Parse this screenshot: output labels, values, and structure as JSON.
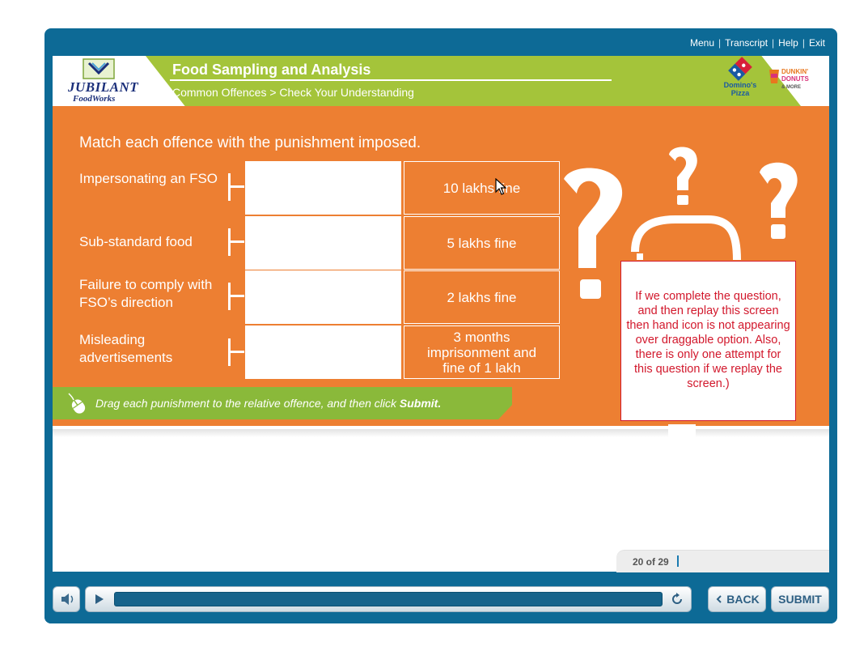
{
  "top_nav": {
    "menu": "Menu",
    "transcript": "Transcript",
    "help": "Help",
    "exit": "Exit"
  },
  "header": {
    "title": "Food Sampling and Analysis",
    "breadcrumb": "Common Offences > Check Your Understanding",
    "logo_left": {
      "name": "JUBILANT",
      "sub": "FoodWorks"
    },
    "logo_dominos": {
      "line1": "Domino's",
      "line2": "Pizza"
    },
    "logo_dunkin": {
      "line1": "DUNKIN'",
      "line2": "DONUTS",
      "line3": "& MORE"
    }
  },
  "activity": {
    "question": "Match each offence with the punishment imposed.",
    "offences": [
      "Impersonating an FSO",
      "Sub-standard food",
      "Failure to comply with FSO’s direction",
      "Misleading advertisements"
    ],
    "options": [
      "10 lakhs fine",
      "5 lakhs fine",
      "2 lakhs fine",
      "3 months imprisonment and fine of 1 lakh"
    ],
    "instruction_prefix": "Drag each punishment to the relative offence, and then click ",
    "instruction_action": "Submit."
  },
  "review_note": "If we complete the question, and then replay this screen then hand icon is not appearing over draggable option. Also, there is only one attempt for this question if we replay the screen.)",
  "footer": {
    "page_indicator": "20 of 29",
    "back_label": "BACK",
    "submit_label": "SUBMIT"
  },
  "colors": {
    "frame": "#0d6a96",
    "stage_orange": "#ed7f32",
    "header_green": "#a4c43a",
    "instruction_green": "#8ab93a",
    "note_red": "#d2182c"
  },
  "icons": [
    "speaker-icon",
    "play-icon",
    "replay-icon",
    "chevron-left-icon",
    "mouse-icon",
    "question-mark-graphic",
    "mouse-cursor"
  ]
}
